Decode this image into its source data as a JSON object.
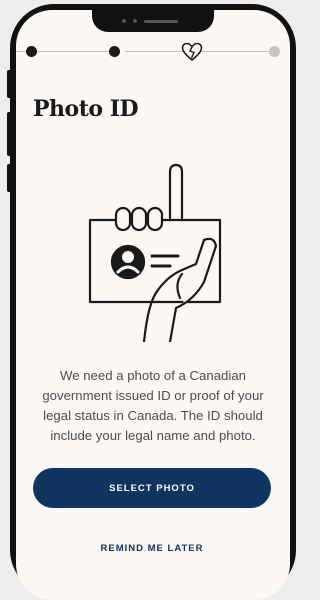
{
  "progress": {
    "steps": [
      {
        "state": "done",
        "color": "#1a1a1a"
      },
      {
        "state": "done",
        "color": "#1a1a1a"
      },
      {
        "state": "current",
        "icon": "heart-outline-icon"
      },
      {
        "state": "upcoming",
        "color": "#c4c4c4"
      }
    ]
  },
  "page": {
    "title": "Photo ID",
    "description": "We need a photo of a Canadian government issued ID or proof of your legal status in Canada. The ID should include your legal name and photo."
  },
  "actions": {
    "primary_label": "SELECT PHOTO",
    "secondary_label": "REMIND ME LATER"
  },
  "illustration": {
    "icon": "hand-holding-id-card-icon"
  },
  "colors": {
    "accent": "#0f3460",
    "background": "#fbf8f6",
    "text": "#4d4d4d"
  }
}
